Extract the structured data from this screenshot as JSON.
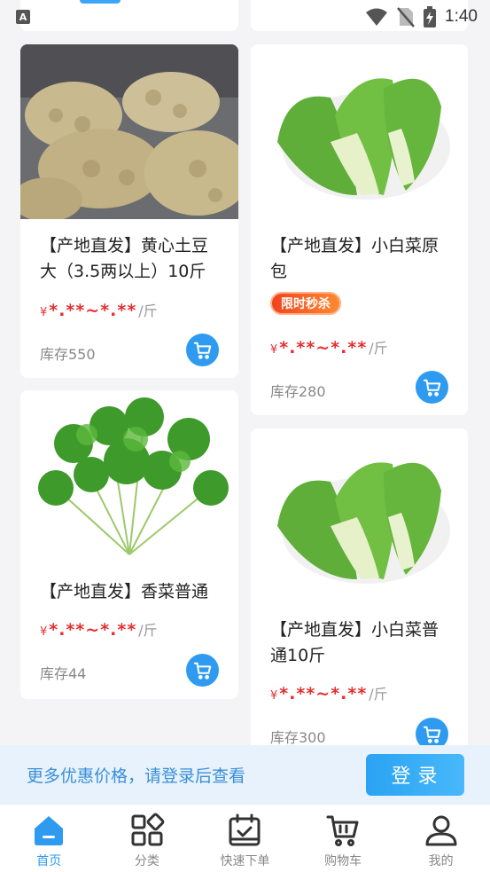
{
  "status_bar": {
    "left_badge": "A",
    "time": "1:40",
    "icons": [
      "wifi-icon",
      "no-sim-icon",
      "battery-charging-icon"
    ]
  },
  "products": [
    {
      "title": "【产地直发】黄心土豆大（3.5两以上）10斤",
      "price_symbol": "¥",
      "price": "*.**~*.**",
      "unit": "/斤",
      "stock": "库存550",
      "badge": ""
    },
    {
      "title": "【产地直发】小白菜原包",
      "price_symbol": "¥",
      "price": "*.**~*.**",
      "unit": "/斤",
      "stock": "库存280",
      "badge": "限时秒杀"
    },
    {
      "title": "【产地直发】香菜普通",
      "price_symbol": "¥",
      "price": "*.**~*.**",
      "unit": "/斤",
      "stock": "库存44",
      "badge": ""
    },
    {
      "title": "【产地直发】小白菜普通10斤",
      "price_symbol": "¥",
      "price": "*.**~*.**",
      "unit": "/斤",
      "stock": "库存300",
      "badge": ""
    }
  ],
  "login_banner": {
    "hint": "更多优惠价格，请登录后查看",
    "button": "登录"
  },
  "tabs": [
    {
      "label": "首页",
      "icon": "home-icon",
      "active": true
    },
    {
      "label": "分类",
      "icon": "category-icon",
      "active": false
    },
    {
      "label": "快速下单",
      "icon": "quick-order-icon",
      "active": false
    },
    {
      "label": "购物车",
      "icon": "cart-icon",
      "active": false
    },
    {
      "label": "我的",
      "icon": "profile-icon",
      "active": false
    }
  ],
  "colors": {
    "accent": "#2e9bf0",
    "price": "#e52e2e",
    "background": "#f4f4f6"
  }
}
